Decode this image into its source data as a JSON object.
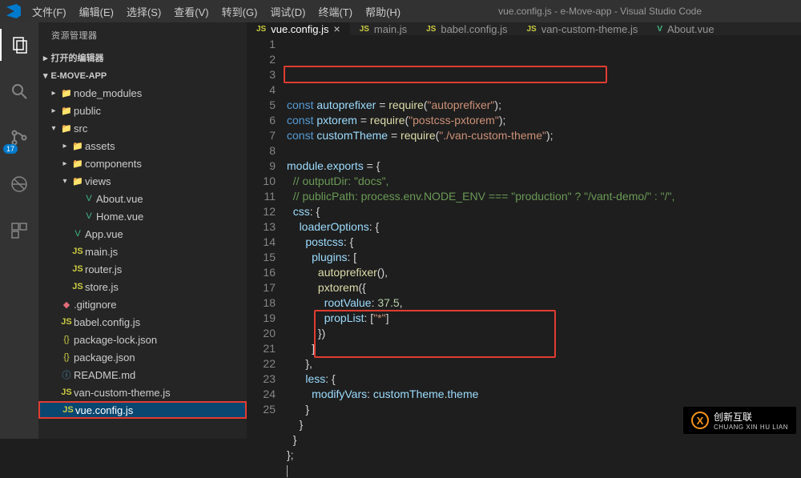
{
  "window": {
    "title": "vue.config.js - e-Move-app - Visual Studio Code"
  },
  "menu": [
    "文件(F)",
    "编辑(E)",
    "选择(S)",
    "查看(V)",
    "转到(G)",
    "调试(D)",
    "终端(T)",
    "帮助(H)"
  ],
  "sidebar": {
    "title": "资源管理器",
    "sections": {
      "open_editors": "打开的编辑器",
      "project": "E-MOVE-APP"
    },
    "tree": [
      {
        "depth": 0,
        "chev": "▸",
        "icon": "folder",
        "iconText": "",
        "label": "node_modules"
      },
      {
        "depth": 0,
        "chev": "▸",
        "icon": "folder",
        "iconText": "",
        "label": "public"
      },
      {
        "depth": 0,
        "chev": "▾",
        "icon": "folder",
        "iconText": "",
        "label": "src"
      },
      {
        "depth": 1,
        "chev": "▸",
        "icon": "folder",
        "iconText": "",
        "label": "assets"
      },
      {
        "depth": 1,
        "chev": "▸",
        "icon": "folder",
        "iconText": "",
        "label": "components"
      },
      {
        "depth": 1,
        "chev": "▾",
        "icon": "folder",
        "iconText": "",
        "label": "views"
      },
      {
        "depth": 2,
        "chev": "",
        "icon": "vue",
        "iconText": "V",
        "label": "About.vue"
      },
      {
        "depth": 2,
        "chev": "",
        "icon": "vue",
        "iconText": "V",
        "label": "Home.vue"
      },
      {
        "depth": 1,
        "chev": "",
        "icon": "vue",
        "iconText": "V",
        "label": "App.vue"
      },
      {
        "depth": 1,
        "chev": "",
        "icon": "js",
        "iconText": "JS",
        "label": "main.js"
      },
      {
        "depth": 1,
        "chev": "",
        "icon": "js",
        "iconText": "JS",
        "label": "router.js"
      },
      {
        "depth": 1,
        "chev": "",
        "icon": "js",
        "iconText": "JS",
        "label": "store.js"
      },
      {
        "depth": 0,
        "chev": "",
        "icon": "git",
        "iconText": "◆",
        "label": ".gitignore"
      },
      {
        "depth": 0,
        "chev": "",
        "icon": "js",
        "iconText": "JS",
        "label": "babel.config.js"
      },
      {
        "depth": 0,
        "chev": "",
        "icon": "json",
        "iconText": "{}",
        "label": "package-lock.json"
      },
      {
        "depth": 0,
        "chev": "",
        "icon": "json",
        "iconText": "{}",
        "label": "package.json"
      },
      {
        "depth": 0,
        "chev": "",
        "icon": "md",
        "iconText": "ⓘ",
        "label": "README.md"
      },
      {
        "depth": 0,
        "chev": "",
        "icon": "js",
        "iconText": "JS",
        "label": "van-custom-theme.js"
      },
      {
        "depth": 0,
        "chev": "",
        "icon": "js",
        "iconText": "JS",
        "label": "vue.config.js",
        "selected": true
      }
    ]
  },
  "activity": {
    "badge": "17"
  },
  "tabs": [
    {
      "icon": "JS",
      "label": "vue.config.js",
      "active": true,
      "close": true
    },
    {
      "icon": "JS",
      "label": "main.js"
    },
    {
      "icon": "JS",
      "label": "babel.config.js"
    },
    {
      "icon": "JS",
      "label": "van-custom-theme.js"
    },
    {
      "icon": "V",
      "iconClass": "i-vue",
      "label": "About.vue"
    }
  ],
  "code": {
    "lines": [
      {
        "n": 1,
        "html": "<span class='k-key'>const</span> <span class='k-var'>autoprefixer</span> <span class='k-pn'>=</span> <span class='k-fn'>require</span><span class='k-pn'>(</span><span class='k-str'>\"autoprefixer\"</span><span class='k-pn'>);</span>"
      },
      {
        "n": 2,
        "html": "<span class='k-key'>const</span> <span class='k-var'>pxtorem</span> <span class='k-pn'>=</span> <span class='k-fn'>require</span><span class='k-pn'>(</span><span class='k-str'>\"postcss-pxtorem\"</span><span class='k-pn'>);</span>"
      },
      {
        "n": 3,
        "html": "<span class='k-key'>const</span> <span class='k-var'>customTheme</span> <span class='k-pn'>=</span> <span class='k-fn'>require</span><span class='k-pn'>(</span><span class='k-str'>\"./van-custom-theme\"</span><span class='k-pn'>);</span>"
      },
      {
        "n": 4,
        "html": ""
      },
      {
        "n": 5,
        "html": "<span class='k-var'>module</span><span class='k-pn'>.</span><span class='k-var'>exports</span> <span class='k-pn'>= {</span>"
      },
      {
        "n": 6,
        "html": "  <span class='k-cmt'>// outputDir: \"docs\",</span>"
      },
      {
        "n": 7,
        "html": "  <span class='k-cmt'>// publicPath: process.env.NODE_ENV === \"production\" ? \"/vant-demo/\" : \"/\",</span>"
      },
      {
        "n": 8,
        "html": "  <span class='k-var'>css</span><span class='k-pn'>: {</span>"
      },
      {
        "n": 9,
        "html": "    <span class='k-var'>loaderOptions</span><span class='k-pn'>: {</span>"
      },
      {
        "n": 10,
        "html": "      <span class='k-var'>postcss</span><span class='k-pn'>: {</span>"
      },
      {
        "n": 11,
        "html": "        <span class='k-var'>plugins</span><span class='k-pn'>: [</span>"
      },
      {
        "n": 12,
        "html": "          <span class='k-fn'>autoprefixer</span><span class='k-pn'>(),</span>"
      },
      {
        "n": 13,
        "html": "          <span class='k-fn'>pxtorem</span><span class='k-pn'>({</span>"
      },
      {
        "n": 14,
        "html": "            <span class='k-var'>rootValue</span><span class='k-pn'>:</span> <span class='k-num'>37.5</span><span class='k-pn'>,</span>"
      },
      {
        "n": 15,
        "html": "            <span class='k-var'>propList</span><span class='k-pn'>: [</span><span class='k-str'>\"*\"</span><span class='k-pn'>]</span>"
      },
      {
        "n": 16,
        "html": "          <span class='k-pn'>})</span>"
      },
      {
        "n": 17,
        "html": "        <span class='k-pn'>]</span>"
      },
      {
        "n": 18,
        "html": "      <span class='k-pn'>},</span>"
      },
      {
        "n": 19,
        "html": "      <span class='k-var'>less</span><span class='k-pn'>: {</span>"
      },
      {
        "n": 20,
        "html": "        <span class='k-var'>modifyVars</span><span class='k-pn'>:</span> <span class='k-var'>customTheme</span><span class='k-pn'>.</span><span class='k-var'>theme</span>"
      },
      {
        "n": 21,
        "html": "      <span class='k-pn'>}</span>"
      },
      {
        "n": 22,
        "html": "    <span class='k-pn'>}</span>"
      },
      {
        "n": 23,
        "html": "  <span class='k-pn'>}</span>"
      },
      {
        "n": 24,
        "html": "<span class='k-pn'>};</span>"
      },
      {
        "n": 25,
        "html": "<span class='cursor-bar'></span>"
      }
    ]
  },
  "watermark": {
    "text": "创新互联",
    "sub": "CHUANG XIN HU LIAN"
  }
}
